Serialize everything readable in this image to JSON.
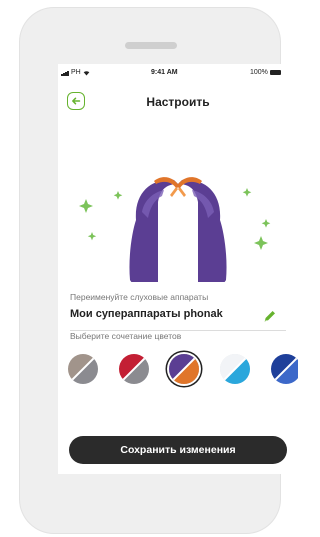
{
  "status_bar": {
    "carrier": "PH",
    "time": "9:41 AM",
    "battery": "100%"
  },
  "header": {
    "title": "Настроить",
    "back_icon": "back-arrow-icon"
  },
  "rename": {
    "label": "Переименуйте слуховые аппараты",
    "device_name": "Мои супераппараты phonak",
    "edit_icon": "pencil-icon"
  },
  "colors": {
    "label": "Выберите сочетание цветов",
    "swatches": [
      {
        "id": "taupe-gray",
        "a": "#a1948b",
        "b": "#8b8b90"
      },
      {
        "id": "red-gray",
        "a": "#c31f34",
        "b": "#8b8b90"
      },
      {
        "id": "purple-orange",
        "a": "#5b3e93",
        "b": "#e0752a",
        "selected": true
      },
      {
        "id": "white-blue",
        "a": "#f2f4f7",
        "b": "#2aa7dc"
      },
      {
        "id": "blue",
        "a": "#1e3f9a",
        "b": "#3c68c9"
      }
    ],
    "accent": "#66b32e"
  },
  "actions": {
    "save_label": "Сохранить изменения"
  }
}
